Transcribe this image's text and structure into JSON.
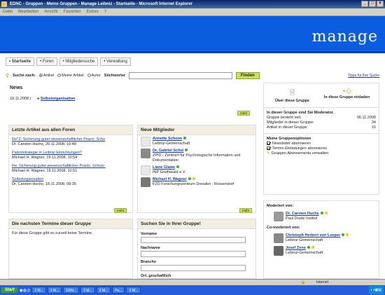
{
  "window": {
    "title": "EDNC - Gruppen - Meine Gruppen - Manage Leibniz - Startseite - Microsoft Internet Explorer"
  },
  "menu": [
    "Datei",
    "Bearbeiten",
    "Ansicht",
    "Favoriten",
    "Extras",
    "?"
  ],
  "logo": "manage",
  "tabs": [
    "• Startseite",
    "• Foren",
    "• Mitgliedersuche",
    "• Verwaltung"
  ],
  "search": {
    "label": "Suche nach:",
    "opt_all": "Artikel",
    "opt_mine": "Meine Artikel",
    "opt_author": "Autor",
    "keyword_label": "Stichworter",
    "find_button": "Finden",
    "tips": "Tipps für Ihre Suche"
  },
  "news": {
    "title": "News",
    "date": "18.11.2008 |",
    "item": "Selbstorganisation",
    "more": "mehr"
  },
  "articles": {
    "title": "Letzte Artikel aus allen Foren",
    "items": [
      {
        "title": "Re^2: Sicherung guter wissenschaftlicher Praxis. Schu",
        "meta": "Dr. Carsten Huchs, 20.11.2008, 10:48"
      },
      {
        "title": "Patentstrategie in Leibniz Einrichtungen?",
        "meta": "Michael H. Wagner, 19.11.2008, 10:54"
      },
      {
        "title": "Re: Sicherung guter wissenschaftlicher Praxis. Schutz-",
        "meta": "Michael H. Wagner, 19.11.2008, 10:51"
      },
      {
        "title": "Selbstorganisation",
        "meta": "Dr. Carsten Huchs, 18.11.2008, 08:35"
      }
    ],
    "more": "mehr"
  },
  "members": {
    "title": "Neue Mitglieder",
    "items": [
      {
        "name": "Annette Schoon",
        "org": "Leibniz-Gemeinschaft"
      },
      {
        "name": "Dr. Gabriel Schui",
        "org": "ZPID - Zentrum für Psychologische Information und Dokumentation"
      },
      {
        "name": "Liane Glawe",
        "org": "INP Greifswald e.V."
      },
      {
        "name": "Michael H. Wagner",
        "org": "FZD Forschungszentrum Dresden - Rossendorf"
      }
    ],
    "more": "mehr"
  },
  "dates": {
    "title": "Die nachsten Termine dieser Gruppe",
    "text": "Für diese Gruppe gibt es zurzeit keine Termine."
  },
  "groupsearch": {
    "title": "Suchen Sie in Ihrer Gruppe!",
    "fields": [
      "Vorname",
      "Nachname",
      "Branche",
      "Ort, geschaftlich"
    ]
  },
  "right": {
    "about_label": "Über diese Gruppe",
    "invite_label": "In diese Gruppe einladen",
    "member_title": "In dieser Gruppe sind Sie Moderator.",
    "stats": [
      {
        "label": "Gruppe besteht seit:",
        "value": "06.11.2008"
      },
      {
        "label": "Mitglieder in dieser Gruppe:",
        "value": "34"
      },
      {
        "label": "Artikel in dieser Gruppe:",
        "value": "10"
      }
    ],
    "options_title": "Meine Gruppenoptionen",
    "options": [
      "Newsletter abonnieren",
      "Termin-Einladungen abonnieren",
      "Gruppen Abonnements verwalten"
    ],
    "moderator_title": "Moderiert von:",
    "moderator": {
      "name": "Dr. Carsten Huchs",
      "org": "Paul Drude Institut"
    },
    "comod_title": "Co-moderiert von:",
    "comods": [
      {
        "name": "Christoph Herbert von Loeper",
        "org": "Leibniz-Gemeinschaft"
      },
      {
        "name": "Josef Zens",
        "org": "Leibniz-Gemeinschaft"
      }
    ]
  },
  "status": {
    "zone": "Internet"
  },
  "taskbar": {
    "start": "Start",
    "tasks": [
      "2 M...",
      "2 M...",
      "EDN...",
      "2 M...",
      "2 M...",
      "Pa...",
      "2 W..."
    ]
  },
  "colors": {
    "banner": "#0b5de0",
    "accent_button": "#c8e05a",
    "link": "#1a3d8f"
  }
}
